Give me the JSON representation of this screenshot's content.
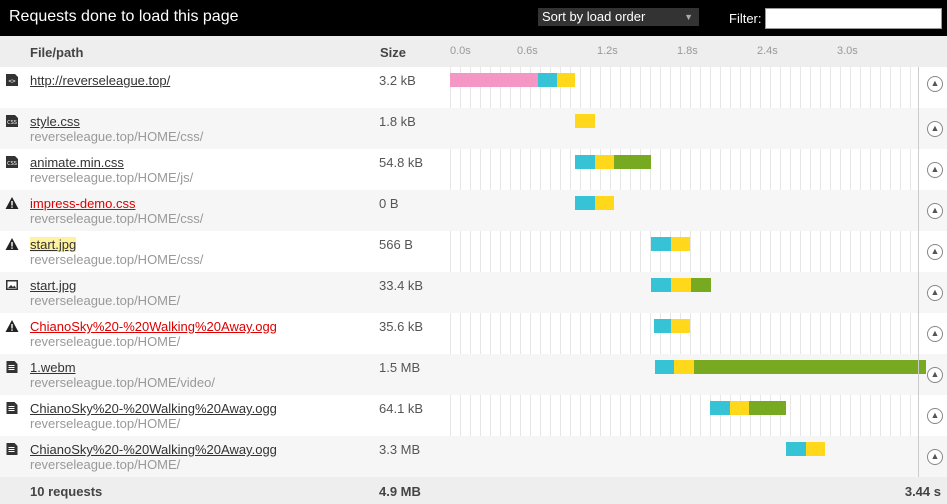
{
  "toolbar": {
    "title": "Requests done to load this page",
    "sort_label": "Sort by load order",
    "filter_label": "Filter:",
    "filter_value": ""
  },
  "columns": {
    "file": "File/path",
    "size": "Size",
    "ticks": [
      "0.0s",
      "0.6s",
      "1.2s",
      "1.8s",
      "2.4s",
      "3.0s"
    ]
  },
  "colors": {
    "blocking": "#f497c4",
    "connect": "#37c3d6",
    "wait": "#ffd81b",
    "receive": "#77aa20"
  },
  "rows": [
    {
      "icon": "html-file-icon",
      "name": "http://reverseleague.top/",
      "path": "",
      "size": "3.2 kB",
      "status": "ok",
      "highlight": false,
      "timing": [
        {
          "type": "blocking",
          "start": 0.0,
          "end": 0.66
        },
        {
          "type": "connect",
          "start": 0.66,
          "end": 0.8
        },
        {
          "type": "wait",
          "start": 0.8,
          "end": 0.94
        }
      ]
    },
    {
      "icon": "css-file-icon",
      "name": "style.css",
      "path": "reverseleague.top/HOME/css/",
      "size": "1.8 kB",
      "status": "ok",
      "highlight": false,
      "timing": [
        {
          "type": "wait",
          "start": 0.94,
          "end": 1.09
        }
      ]
    },
    {
      "icon": "css-file-icon",
      "name": "animate.min.css",
      "path": "reverseleague.top/HOME/js/",
      "size": "54.8 kB",
      "status": "ok",
      "highlight": false,
      "timing": [
        {
          "type": "connect",
          "start": 0.94,
          "end": 1.09
        },
        {
          "type": "wait",
          "start": 1.09,
          "end": 1.23
        },
        {
          "type": "receive",
          "start": 1.23,
          "end": 1.51
        }
      ]
    },
    {
      "icon": "warning-icon",
      "name": "impress-demo.css",
      "path": "reverseleague.top/HOME/css/",
      "size": "0 B",
      "status": "error",
      "highlight": false,
      "timing": [
        {
          "type": "connect",
          "start": 0.94,
          "end": 1.09
        },
        {
          "type": "wait",
          "start": 1.09,
          "end": 1.23
        }
      ]
    },
    {
      "icon": "warning-icon",
      "name": "start.jpg",
      "path": "reverseleague.top/HOME/css/",
      "size": "566 B",
      "status": "ok",
      "highlight": true,
      "timing": [
        {
          "type": "connect",
          "start": 1.51,
          "end": 1.66
        },
        {
          "type": "wait",
          "start": 1.66,
          "end": 1.8
        }
      ]
    },
    {
      "icon": "image-file-icon",
      "name": "start.jpg",
      "path": "reverseleague.top/HOME/",
      "size": "33.4 kB",
      "status": "ok",
      "highlight": false,
      "timing": [
        {
          "type": "connect",
          "start": 1.51,
          "end": 1.66
        },
        {
          "type": "wait",
          "start": 1.66,
          "end": 1.81
        },
        {
          "type": "receive",
          "start": 1.81,
          "end": 1.96
        }
      ]
    },
    {
      "icon": "warning-icon",
      "name": "ChianoSky%20-%20Walking%20Away.ogg",
      "path": "reverseleague.top/HOME/",
      "size": "35.6 kB",
      "status": "error",
      "highlight": false,
      "timing": [
        {
          "type": "connect",
          "start": 1.53,
          "end": 1.66
        },
        {
          "type": "wait",
          "start": 1.66,
          "end": 1.8
        }
      ]
    },
    {
      "icon": "document-file-icon",
      "name": "1.webm",
      "path": "reverseleague.top/HOME/video/",
      "size": "1.5 MB",
      "status": "ok",
      "highlight": false,
      "timing": [
        {
          "type": "connect",
          "start": 1.54,
          "end": 1.68
        },
        {
          "type": "wait",
          "start": 1.68,
          "end": 1.83
        },
        {
          "type": "receive",
          "start": 1.83,
          "end": 3.57
        }
      ]
    },
    {
      "icon": "document-file-icon",
      "name": "ChianoSky%20-%20Walking%20Away.ogg",
      "path": "reverseleague.top/HOME/",
      "size": "64.1 kB",
      "status": "ok",
      "highlight": false,
      "timing": [
        {
          "type": "connect",
          "start": 1.95,
          "end": 2.1
        },
        {
          "type": "wait",
          "start": 2.1,
          "end": 2.24
        },
        {
          "type": "receive",
          "start": 2.24,
          "end": 2.52
        }
      ]
    },
    {
      "icon": "document-file-icon",
      "name": "ChianoSky%20-%20Walking%20Away.ogg",
      "path": "reverseleague.top/HOME/",
      "size": "3.3 MB",
      "status": "ok",
      "highlight": false,
      "timing": [
        {
          "type": "connect",
          "start": 2.52,
          "end": 2.67
        },
        {
          "type": "wait",
          "start": 2.67,
          "end": 2.81
        }
      ]
    }
  ],
  "footer": {
    "count": "10 requests",
    "total_size": "4.9 MB",
    "total_time": "3.44 s"
  }
}
